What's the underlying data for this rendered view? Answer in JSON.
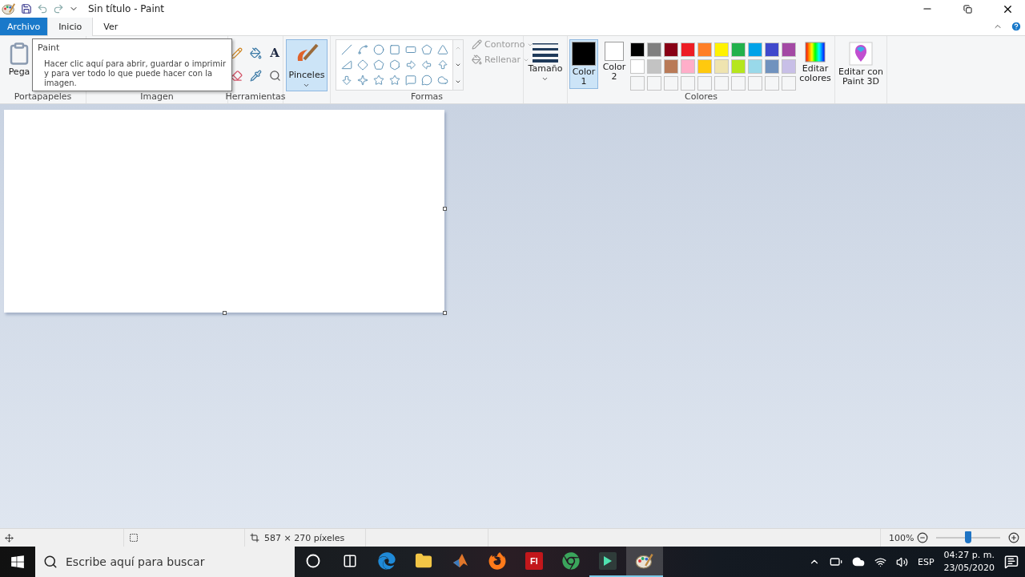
{
  "window": {
    "title": "Sin título - Paint"
  },
  "tabs": [
    {
      "label": "Archivo",
      "kind": "file",
      "selected": false
    },
    {
      "label": "Inicio",
      "kind": "tab",
      "selected": true
    },
    {
      "label": "Ver",
      "kind": "tab",
      "selected": false
    }
  ],
  "tooltip": {
    "title": "Paint",
    "text": "Hacer clic aquí para abrir, guardar o imprimir y para ver todo lo que puede hacer con la imagen."
  },
  "ribbon": {
    "clipboard": {
      "button": "Pega",
      "label": "Portapapeles"
    },
    "image": {
      "label": "Imagen"
    },
    "tools": {
      "label": "Herramientas",
      "items": [
        {
          "kind": "pencil"
        },
        {
          "kind": "fill"
        },
        {
          "kind": "text",
          "glyph": "A"
        },
        {
          "kind": "eraser"
        },
        {
          "kind": "picker"
        },
        {
          "kind": "magnifier"
        }
      ]
    },
    "brushes": {
      "button": "Pinceles"
    },
    "shapes": {
      "label": "Formas",
      "outline": "Contorno",
      "fill": "Rellenar"
    },
    "size": {
      "button": "Tamaño"
    },
    "colors": {
      "label": "Colores",
      "current": [
        {
          "label": "Color 1",
          "color": "#000000",
          "selected": true
        },
        {
          "label": "Color 2",
          "color": "#ffffff",
          "selected": false
        }
      ],
      "palette": [
        {
          "kind": "color",
          "color": "#000000"
        },
        {
          "kind": "color",
          "color": "#7f7f7f"
        },
        {
          "kind": "color",
          "color": "#880015"
        },
        {
          "kind": "color",
          "color": "#ed1c24"
        },
        {
          "kind": "color",
          "color": "#ff7f27"
        },
        {
          "kind": "color",
          "color": "#fff200"
        },
        {
          "kind": "color",
          "color": "#22b14c"
        },
        {
          "kind": "color",
          "color": "#00a2e8"
        },
        {
          "kind": "color",
          "color": "#3f48cc"
        },
        {
          "kind": "color",
          "color": "#a349a4"
        },
        {
          "kind": "color",
          "color": "#ffffff"
        },
        {
          "kind": "color",
          "color": "#c3c3c3"
        },
        {
          "kind": "color",
          "color": "#b97a57"
        },
        {
          "kind": "color",
          "color": "#ffaec9"
        },
        {
          "kind": "color",
          "color": "#ffc90e"
        },
        {
          "kind": "color",
          "color": "#efe4b0"
        },
        {
          "kind": "color",
          "color": "#b5e61d"
        },
        {
          "kind": "color",
          "color": "#99d9ea"
        },
        {
          "kind": "color",
          "color": "#7092be"
        },
        {
          "kind": "color",
          "color": "#c8bfe7"
        },
        {
          "kind": "empty"
        },
        {
          "kind": "empty"
        },
        {
          "kind": "empty"
        },
        {
          "kind": "empty"
        },
        {
          "kind": "empty"
        },
        {
          "kind": "empty"
        },
        {
          "kind": "empty"
        },
        {
          "kind": "empty"
        },
        {
          "kind": "empty"
        },
        {
          "kind": "empty"
        }
      ],
      "edit": "Editar colores"
    },
    "paint3d": {
      "button": "Editar con Paint 3D"
    }
  },
  "status_bar": {
    "size": "587 × 270 píxeles",
    "zoom": "100%",
    "zoom_slider": {
      "level": 0.5
    }
  },
  "taskbar": {
    "search": {
      "placeholder": "Escribe aquí para buscar"
    },
    "apps": [
      {
        "kind": "cortana",
        "running": false,
        "selected": false
      },
      {
        "kind": "taskview",
        "running": false,
        "selected": false
      },
      {
        "kind": "edge",
        "running": false,
        "selected": false
      },
      {
        "kind": "explorer",
        "running": false,
        "selected": false
      },
      {
        "kind": "matlab",
        "running": false,
        "selected": false
      },
      {
        "kind": "firefox",
        "running": false,
        "selected": false
      },
      {
        "kind": "flash",
        "label": "Fl",
        "running": false,
        "selected": false
      },
      {
        "kind": "chrome",
        "running": false,
        "selected": false
      },
      {
        "kind": "filmora",
        "running": true,
        "selected": false
      },
      {
        "kind": "paint",
        "running": true,
        "selected": true
      }
    ],
    "language": "ESP",
    "time": "04:27 p. m.",
    "date": "23/05/2020"
  }
}
